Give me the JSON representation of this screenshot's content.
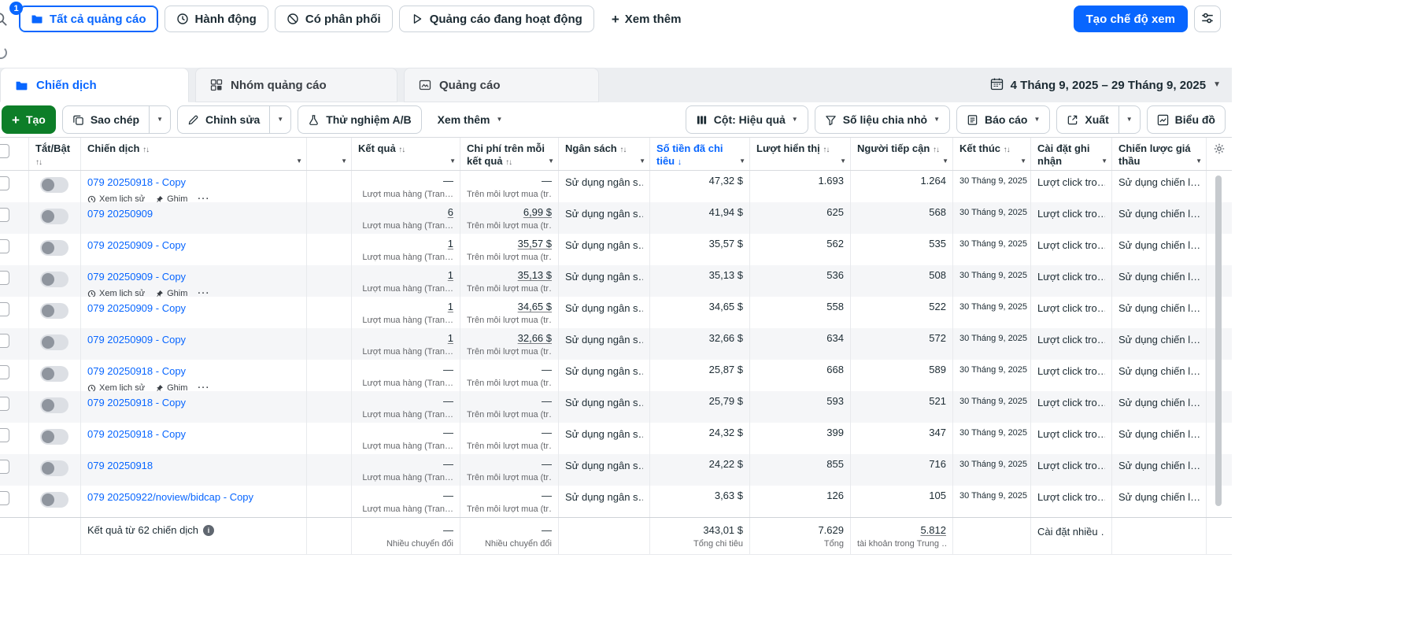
{
  "filter_bar": {
    "badge_count": "1",
    "chips": [
      {
        "label": "Tất cả quảng cáo"
      },
      {
        "label": "Hành động"
      },
      {
        "label": "Có phân phối"
      },
      {
        "label": "Quảng cáo đang hoạt động"
      }
    ],
    "more_label": "Xem thêm",
    "create_view_label": "Tạo chế độ xem"
  },
  "tabs": {
    "items": [
      {
        "label": "Chiến dịch"
      },
      {
        "label": "Nhóm quảng cáo"
      },
      {
        "label": "Quảng cáo"
      }
    ],
    "date_range": "4 Tháng 9, 2025 – 29 Tháng 9, 2025"
  },
  "toolbar": {
    "create_label": "Tạo",
    "duplicate_label": "Sao chép",
    "edit_label": "Chỉnh sửa",
    "ab_test_label": "Thử nghiệm A/B",
    "more_label": "Xem thêm",
    "columns_label": "Cột: Hiệu quả",
    "breakdown_label": "Số liệu chia nhỏ",
    "report_label": "Báo cáo",
    "export_label": "Xuất",
    "chart_label": "Biểu đồ"
  },
  "colors": {
    "accent_blue": "#0866FF",
    "create_green": "#0d7e28"
  },
  "table": {
    "headers": {
      "toggle": "Tắt/Bật",
      "campaign": "Chiến dịch",
      "result": "Kết quả",
      "cost_per_result": "Chi phí trên mỗi kết quả",
      "budget": "Ngân sách",
      "spent": "Số tiền đã chi tiêu",
      "impressions": "Lượt hiển thị",
      "reach": "Người tiếp cận",
      "end": "Kết thúc",
      "attribution": "Cài đặt ghi nhận",
      "bid_strategy": "Chiến lược giá thầu"
    },
    "history_label": "Xem lịch sử",
    "pin_label": "Ghim",
    "row_common": {
      "result_sub": "Lượt mua hàng (Tran…",
      "cost_sub": "Trên mỗi lượt mua (tr…",
      "budget": "Sử dụng ngân s…",
      "end_date": "30 Tháng 9, 2025",
      "attribution": "Lượt click tro…",
      "bid_strategy": "Sử dụng chiến l…"
    },
    "rows": [
      {
        "name": "079 20250918 - Copy",
        "has_history": true,
        "result": "—",
        "cost": "—",
        "spent": "47,32 $",
        "impressions": "1.693",
        "reach": "1.264"
      },
      {
        "name": "079 20250909",
        "has_history": false,
        "result": "6",
        "cost": "6,99 $",
        "spent": "41,94 $",
        "impressions": "625",
        "reach": "568"
      },
      {
        "name": "079 20250909 - Copy",
        "has_history": false,
        "result": "1",
        "cost": "35,57 $",
        "spent": "35,57 $",
        "impressions": "562",
        "reach": "535"
      },
      {
        "name": "079 20250909 - Copy",
        "has_history": true,
        "result": "1",
        "cost": "35,13 $",
        "spent": "35,13 $",
        "impressions": "536",
        "reach": "508"
      },
      {
        "name": "079 20250909 - Copy",
        "has_history": false,
        "result": "1",
        "cost": "34,65 $",
        "spent": "34,65 $",
        "impressions": "558",
        "reach": "522"
      },
      {
        "name": "079 20250909 - Copy",
        "has_history": false,
        "result": "1",
        "cost": "32,66 $",
        "spent": "32,66 $",
        "impressions": "634",
        "reach": "572"
      },
      {
        "name": "079 20250918 - Copy",
        "has_history": true,
        "result": "—",
        "cost": "—",
        "spent": "25,87 $",
        "impressions": "668",
        "reach": "589"
      },
      {
        "name": "079 20250918 - Copy",
        "has_history": false,
        "result": "—",
        "cost": "—",
        "spent": "25,79 $",
        "impressions": "593",
        "reach": "521"
      },
      {
        "name": "079 20250918 - Copy",
        "has_history": false,
        "result": "—",
        "cost": "—",
        "spent": "24,32 $",
        "impressions": "399",
        "reach": "347"
      },
      {
        "name": "079 20250918",
        "has_history": false,
        "result": "—",
        "cost": "—",
        "spent": "24,22 $",
        "impressions": "855",
        "reach": "716"
      },
      {
        "name": "079 20250922/noview/bidcap - Copy",
        "has_history": false,
        "result": "—",
        "cost": "—",
        "spent": "3,63 $",
        "impressions": "126",
        "reach": "105"
      }
    ],
    "footer": {
      "label": "Kết quả từ 62 chiến dịch",
      "result": "—",
      "result_sub": "Nhiều chuyển đổi",
      "cost": "—",
      "cost_sub": "Nhiều chuyển đổi",
      "spent": "343,01 $",
      "spent_sub": "Tổng chi tiêu",
      "impressions": "7.629",
      "impressions_sub": "Tổng",
      "reach": "5.812",
      "reach_sub": "tài khoản trong Trung …",
      "attribution": "Cài đặt nhiều …"
    }
  }
}
